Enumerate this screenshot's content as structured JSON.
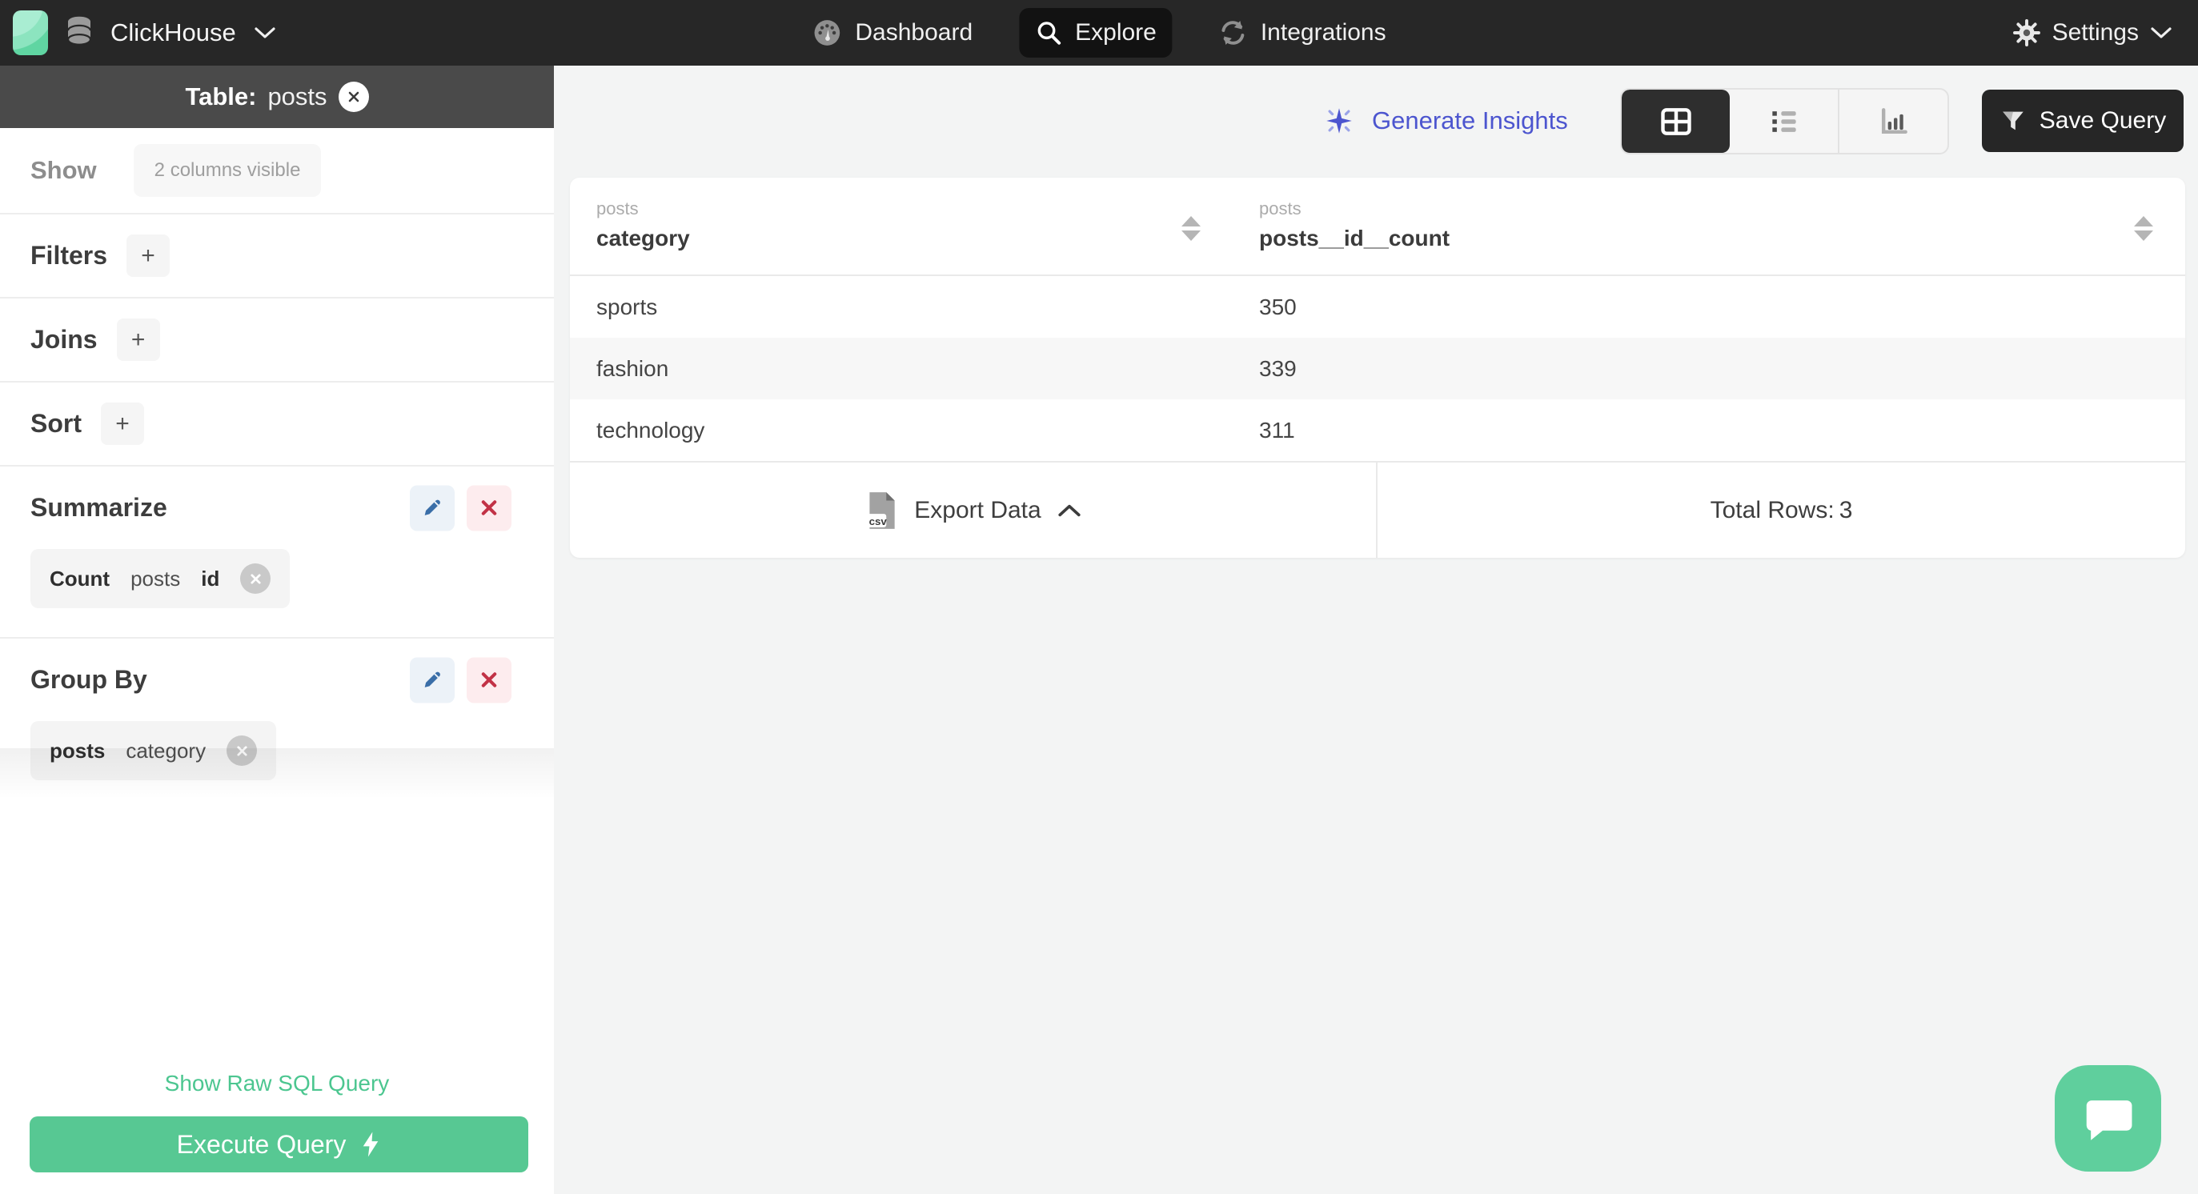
{
  "navbar": {
    "brand": "ClickHouse",
    "nav_items": [
      {
        "label": "Dashboard"
      },
      {
        "label": "Explore"
      },
      {
        "label": "Integrations"
      }
    ],
    "settings_label": "Settings"
  },
  "sidebar": {
    "table_label_prefix": "Table:",
    "table_name": "posts",
    "show_label": "Show",
    "show_chip": "2 columns visible",
    "filters_label": "Filters",
    "joins_label": "Joins",
    "sort_label": "Sort",
    "add_button": "+",
    "summarize_label": "Summarize",
    "summarize_chip": {
      "agg": "Count",
      "table": "posts",
      "column": "id"
    },
    "group_by_label": "Group By",
    "group_by_chip": {
      "table": "posts",
      "column": "category"
    },
    "raw_sql_link": "Show Raw SQL Query",
    "execute_button": "Execute Query"
  },
  "toolbar": {
    "generate_insights_label": "Generate Insights",
    "save_query_label": "Save Query"
  },
  "results": {
    "columns": [
      {
        "table": "posts",
        "name": "category"
      },
      {
        "table": "posts",
        "name": "posts__id__count"
      }
    ],
    "rows": [
      [
        "sports",
        "350"
      ],
      [
        "fashion",
        "339"
      ],
      [
        "technology",
        "311"
      ]
    ],
    "export_label": "Export Data",
    "csv_label": "csv",
    "total_rows_label": "Total Rows:",
    "total_rows_value": "3"
  },
  "colors": {
    "navbar_bg": "#272727",
    "accent_green": "#57c893",
    "link_green": "#4cc690",
    "accent_indigo": "#4c55cf",
    "edit_blue": "#3a6ea8",
    "danger_red": "#c23246"
  }
}
